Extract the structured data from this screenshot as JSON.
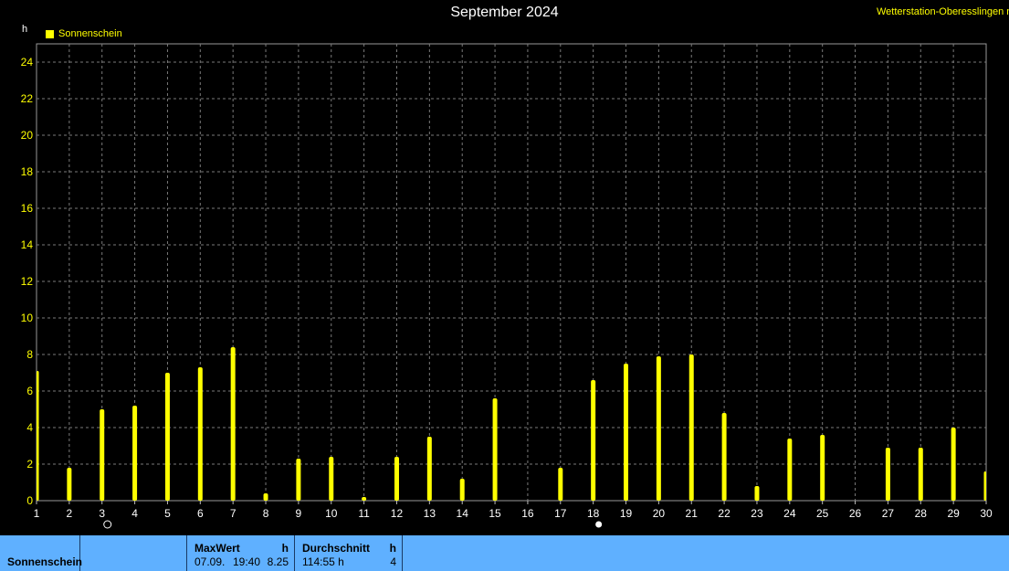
{
  "header": {
    "title": "September 2024",
    "station": "Wetterstation-Oberesslingen n"
  },
  "chart_data": {
    "type": "bar",
    "title": "September 2024",
    "ylabel": "h",
    "ylim": [
      0,
      25
    ],
    "yticks": [
      0,
      2,
      4,
      6,
      8,
      10,
      12,
      14,
      16,
      18,
      20,
      22,
      24
    ],
    "grid": true,
    "legend_position": "top-left",
    "categories": [
      "1",
      "2",
      "3",
      "4",
      "5",
      "6",
      "7",
      "8",
      "9",
      "10",
      "11",
      "12",
      "13",
      "14",
      "15",
      "16",
      "17",
      "18",
      "19",
      "20",
      "21",
      "22",
      "23",
      "24",
      "25",
      "26",
      "27",
      "28",
      "29",
      "30"
    ],
    "series": [
      {
        "name": "Sonnenschein",
        "color": "#ffff00",
        "values": [
          7.1,
          1.8,
          5.0,
          5.2,
          7.0,
          7.3,
          8.4,
          0.4,
          2.3,
          2.4,
          0.2,
          2.4,
          3.5,
          1.2,
          5.6,
          0.0,
          1.8,
          6.6,
          7.5,
          7.9,
          8.0,
          4.8,
          0.8,
          3.4,
          3.6,
          0.0,
          2.9,
          2.9,
          4.0,
          1.6
        ]
      }
    ],
    "moon_phases": [
      {
        "day": 3,
        "phase": "new"
      },
      {
        "day": 18,
        "phase": "full"
      }
    ]
  },
  "footer": {
    "label": "Sonnenschein",
    "max": {
      "title": "MaxWert",
      "unit": "h",
      "date": "07.09.",
      "time": "19:40",
      "value": "8.25"
    },
    "avg": {
      "title": "Durchschnitt",
      "unit": "h",
      "total": "114:55 h",
      "value": "4"
    }
  }
}
